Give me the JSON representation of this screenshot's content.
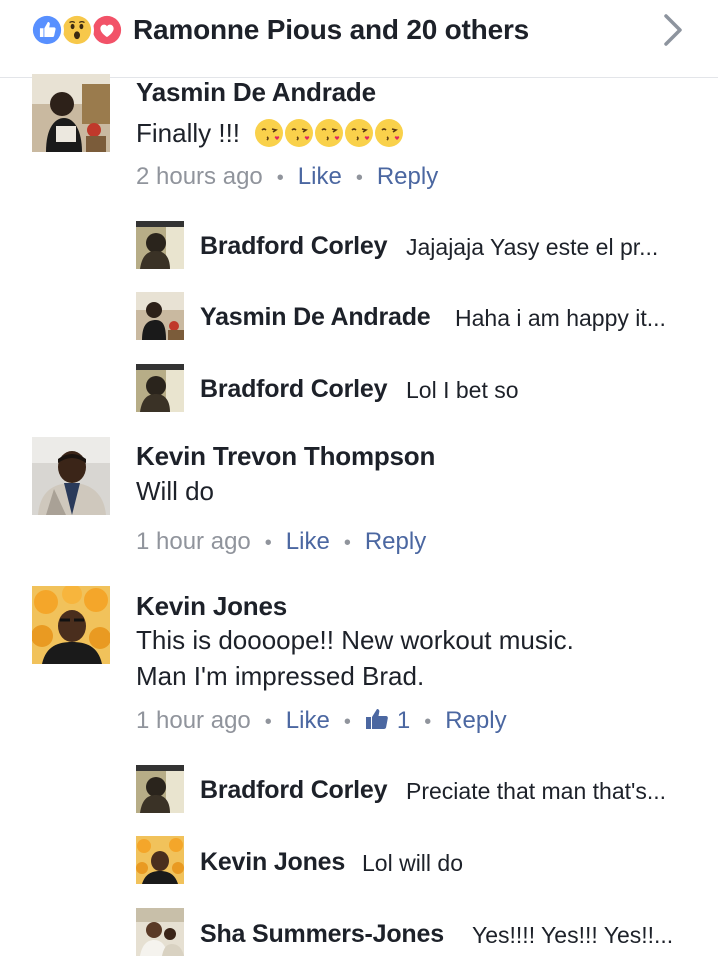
{
  "header": {
    "title": "Ramonne Pious and 20 others",
    "reaction_icons": [
      "like-icon",
      "wow-icon",
      "love-icon"
    ]
  },
  "colors": {
    "link": "#4b67a1",
    "meta": "#90949c",
    "like_blue": "#5890ff",
    "love_red": "#f25268",
    "text": "#1d2129"
  },
  "comments": [
    {
      "author": "Yasmin De Andrade",
      "text": "Finally !!!",
      "emoji_count": 5,
      "time": "2 hours ago",
      "like_label": "Like",
      "reply_label": "Reply",
      "replies": [
        {
          "author": "Bradford Corley",
          "text": "Jajajaja Yasy este el pr..."
        },
        {
          "author": "Yasmin De Andrade",
          "text": "Haha i am happy it..."
        },
        {
          "author": "Bradford Corley",
          "text": "Lol I bet so"
        }
      ]
    },
    {
      "author": "Kevin Trevon Thompson",
      "text": "Will do",
      "time": "1 hour ago",
      "like_label": "Like",
      "reply_label": "Reply",
      "replies": []
    },
    {
      "author": "Kevin Jones",
      "text_lines": [
        "This is doooope!! New workout music.",
        "Man I'm impressed Brad."
      ],
      "time": "1 hour ago",
      "like_label": "Like",
      "like_count": "1",
      "reply_label": "Reply",
      "replies": [
        {
          "author": "Bradford Corley",
          "text": "Preciate that man that's..."
        },
        {
          "author": "Kevin Jones",
          "text": "Lol will do"
        },
        {
          "author": "Sha Summers-Jones",
          "text": "Yes!!!! Yes!!! Yes!!..."
        }
      ]
    }
  ]
}
